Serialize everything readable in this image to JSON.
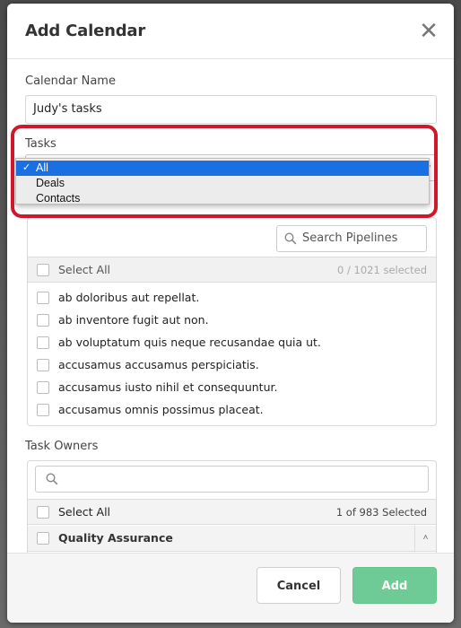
{
  "modal": {
    "title": "Add Calendar",
    "close_glyph": "✕"
  },
  "calendar_name": {
    "label": "Calendar Name",
    "value": "Judy's tasks"
  },
  "tasks": {
    "label": "Tasks",
    "selected": "All",
    "options": [
      "All",
      "Deals",
      "Contacts"
    ],
    "check_glyph": "✓"
  },
  "pipelines": {
    "search_placeholder": "Search Pipelines",
    "select_all_label": "Select All",
    "count_text": "0 / 1021 selected",
    "items": [
      "ab doloribus aut repellat.",
      "ab inventore fugit aut non.",
      "ab voluptatum quis neque recusandae quia ut.",
      "accusamus accusamus perspiciatis.",
      "accusamus iusto nihil et consequuntur.",
      "accusamus omnis possimus placeat."
    ]
  },
  "task_owners": {
    "label": "Task Owners",
    "search_placeholder": "",
    "select_all_label": "Select All",
    "count_text": "1 of 983 Selected",
    "items": [
      "Quality Assurance"
    ],
    "group_toggle_glyph": "˄"
  },
  "footer": {
    "cancel_label": "Cancel",
    "add_label": "Add"
  },
  "colors": {
    "highlight_outline": "#d0182a",
    "selected_option": "#1a6fe3",
    "add_button": "#6ecb96"
  },
  "icons": [
    "close-icon",
    "search-icon",
    "check-icon",
    "chevron-up-icon"
  ]
}
